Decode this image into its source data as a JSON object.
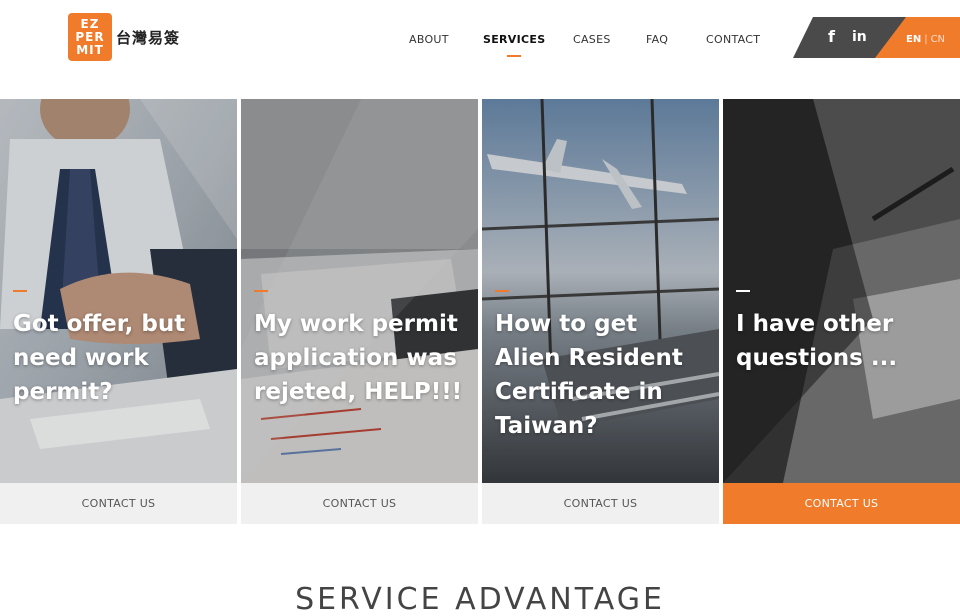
{
  "brand": {
    "logo_lines": [
      "EZ",
      "PER",
      "MIT"
    ],
    "name": "台灣易簽",
    "accent_color": "#f07b2b"
  },
  "nav": {
    "items": [
      {
        "label": "ABOUT",
        "active": false
      },
      {
        "label": "SERVICES",
        "active": true
      },
      {
        "label": "CASES",
        "active": false
      },
      {
        "label": "FAQ",
        "active": false
      },
      {
        "label": "CONTACT",
        "active": false
      }
    ]
  },
  "social": {
    "facebook_glyph": "f",
    "linkedin_glyph": "in"
  },
  "language": {
    "en": "EN",
    "separator": "|",
    "cn": "CN"
  },
  "cards": [
    {
      "title": "Got offer, but need work permit?",
      "button": "CONTACT US",
      "image_icon": "handshake-photo"
    },
    {
      "title": "My work permit application was rejeted, HELP!!!",
      "button": "CONTACT US",
      "image_icon": "document-photo"
    },
    {
      "title": "How to get Alien Resident Certificate in Taiwan?",
      "button": "CONTACT US",
      "image_icon": "airport-photo"
    },
    {
      "title": "I have other questions ...",
      "button": "CONTACT US",
      "image_icon": "writing-photo"
    }
  ],
  "section": {
    "title": "SERVICE ADVANTAGE"
  }
}
